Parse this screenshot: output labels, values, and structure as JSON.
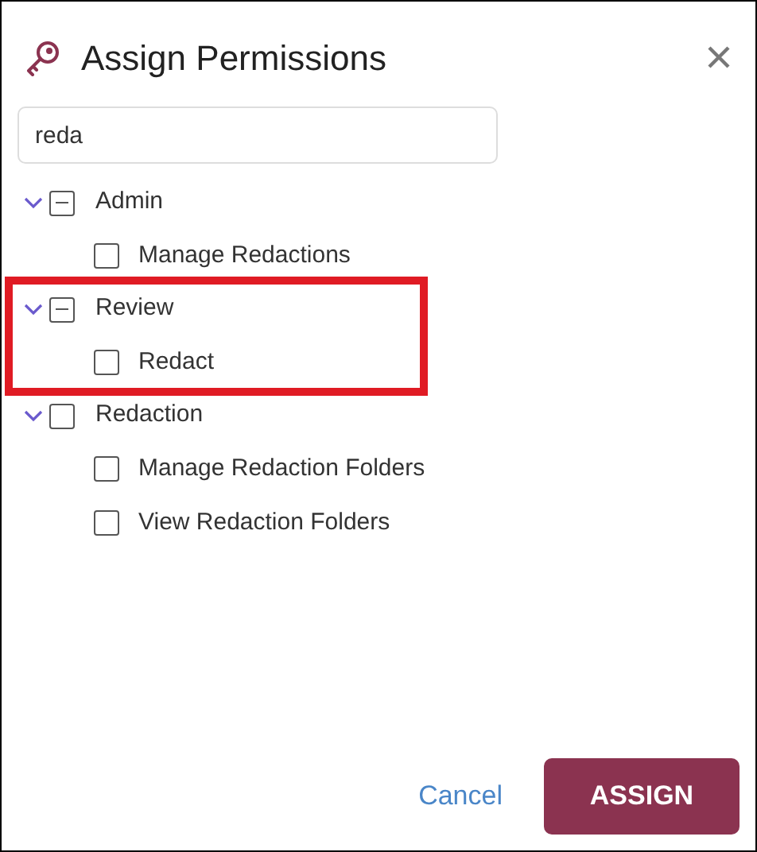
{
  "dialog": {
    "title": "Assign Permissions",
    "search": {
      "value": "reda"
    },
    "tree": [
      {
        "label": "Admin",
        "expanded": true,
        "indeterminate": true,
        "highlighted": false,
        "children": [
          {
            "label": "Manage Redactions",
            "checked": false
          }
        ]
      },
      {
        "label": "Review",
        "expanded": true,
        "indeterminate": true,
        "highlighted": true,
        "children": [
          {
            "label": "Redact",
            "checked": false
          }
        ]
      },
      {
        "label": "Redaction",
        "expanded": true,
        "indeterminate": false,
        "highlighted": false,
        "children": [
          {
            "label": "Manage Redaction Folders",
            "checked": false
          },
          {
            "label": "View Redaction Folders",
            "checked": false
          }
        ]
      }
    ],
    "buttons": {
      "cancel": "Cancel",
      "assign": "ASSIGN"
    }
  }
}
